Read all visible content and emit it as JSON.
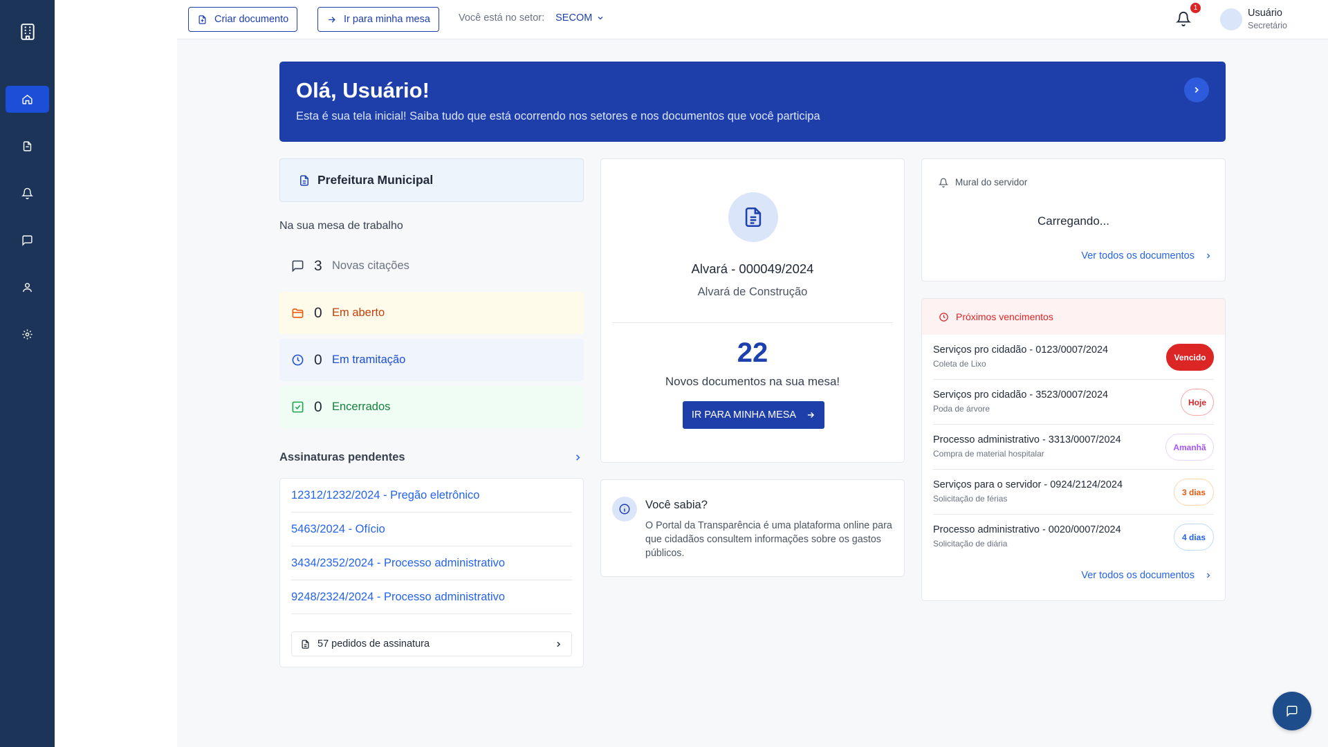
{
  "header": {
    "create_doc_label": "Criar documento",
    "go_desk_label": "Ir para minha mesa",
    "sector_prefix": "Você está no setor:",
    "sector_value": "SECOM",
    "notification_count": "1",
    "user_name": "Usuário",
    "user_role": "Secretário"
  },
  "sidebar": {
    "items": [
      {
        "icon": "home-icon",
        "active": true
      },
      {
        "icon": "documents-icon",
        "active": false
      },
      {
        "icon": "bell-icon",
        "active": false
      },
      {
        "icon": "chat-icon",
        "active": false
      },
      {
        "icon": "user-icon",
        "active": false
      },
      {
        "icon": "gear-icon",
        "active": false
      }
    ]
  },
  "banner": {
    "title": "Olá, Usuário!",
    "subtitle": "Esta é sua tela inicial! Saiba tudo que está ocorrendo nos setores e nos documentos que você participa"
  },
  "org": {
    "name": "Prefeitura Municipal"
  },
  "desk": {
    "title": "Na sua mesa de trabalho",
    "stats": [
      {
        "count": "3",
        "label": "Novas citações",
        "color": "#6b7280",
        "bg": "transparent",
        "icon": "chat-icon"
      },
      {
        "count": "0",
        "label": "Em aberto",
        "color": "#c2410c",
        "bg": "#fffbeb",
        "icon": "folder-icon"
      },
      {
        "count": "0",
        "label": "Em tramitação",
        "color": "#1d4ed8",
        "bg": "#eff4fd",
        "icon": "clock-icon"
      },
      {
        "count": "0",
        "label": "Encerrados",
        "color": "#15803d",
        "bg": "#f0fdf4",
        "icon": "check-square-icon"
      }
    ]
  },
  "signatures": {
    "title": "Assinaturas pendentes",
    "items": [
      "12312/1232/2024 - Pregão eletrônico",
      "5463/2024 - Ofício",
      "3434/2352/2024 - Processo administrativo",
      "9248/2324/2024 - Processo administrativo"
    ],
    "footer": "57 pedidos de assinatura"
  },
  "document": {
    "number": "Alvará - 000049/2024",
    "type": "Alvará de Construção",
    "new_count": "22",
    "new_label": "Novos documentos na sua mesa!",
    "button": "IR PARA MINHA MESA"
  },
  "tip": {
    "title": "Você sabia?",
    "text": "O Portal da Transparência é uma plataforma online para que cidadãos consultem informações sobre os gastos públicos."
  },
  "mural": {
    "title": "Mural do servidor",
    "loading": "Carregando...",
    "link": "Ver todos os documentos"
  },
  "deadlines": {
    "title": "Próximos vencimentos",
    "link": "Ver todos os documentos",
    "items": [
      {
        "title": "Serviços pro cidadão - 0123/0007/2024",
        "sub": "Coleta de Lixo",
        "status": "Vencido",
        "fg": "#ffffff",
        "bg": "#dc2626",
        "border": "#dc2626"
      },
      {
        "title": "Serviços pro cidadão - 3523/0007/2024",
        "sub": "Poda de árvore",
        "status": "Hoje",
        "fg": "#dc2626",
        "bg": "#ffffff",
        "border": "#fca5a5"
      },
      {
        "title": "Processo administrativo - 3313/0007/2024",
        "sub": "Compra de material hospitalar",
        "status": "Amanhã",
        "fg": "#a855f7",
        "bg": "#ffffff",
        "border": "#e9d5ff"
      },
      {
        "title": "Serviços para o servidor - 0924/2124/2024",
        "sub": "Solicitação de férias",
        "status": "3 dias",
        "fg": "#ea580c",
        "bg": "#ffffff",
        "border": "#fed7aa"
      },
      {
        "title": "Processo administrativo - 0020/0007/2024",
        "sub": "Solicitação de diária",
        "status": "4 dias",
        "fg": "#2563eb",
        "bg": "#ffffff",
        "border": "#bfdbfe"
      }
    ]
  }
}
